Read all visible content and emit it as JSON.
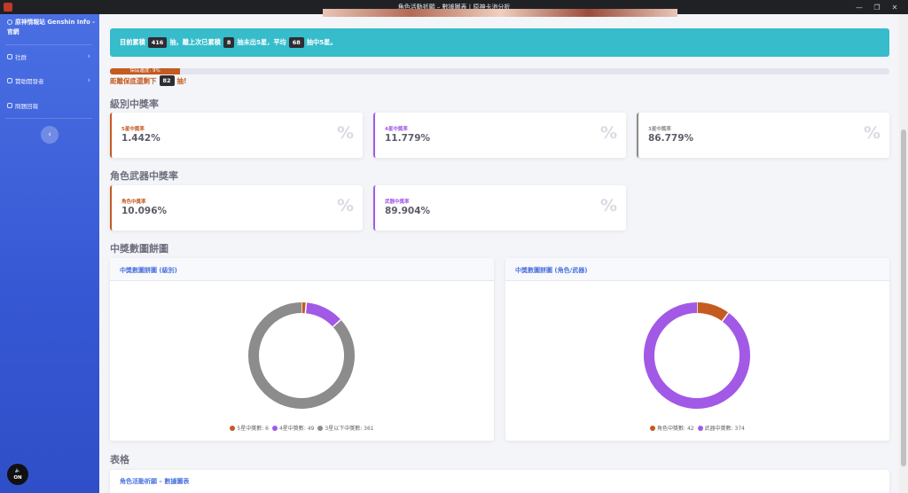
{
  "window": {
    "title": "角色活動祈願 – 數據圖表 | 原神卡池分析",
    "controls": {
      "minimize": "—",
      "maximize": "❐",
      "close": "✕"
    }
  },
  "sidebar": {
    "brand": "原神情報站 Genshin Info - 官網",
    "items": [
      {
        "label": "社群",
        "icon": "users-icon",
        "chevron": "›"
      },
      {
        "label": "贊助開發者",
        "icon": "heart-icon",
        "chevron": "›"
      },
      {
        "label": "問題回報",
        "icon": "feedback-icon"
      }
    ],
    "collapse_symbol": "‹",
    "audio_label": "ON"
  },
  "summary": {
    "prefix": "目前累積",
    "total_pulls": "416",
    "mid1": "抽，離上次已累積",
    "since_last": "8",
    "mid2": "抽未出5星，平均",
    "avg": "68",
    "suffix": "抽中5星。"
  },
  "pity": {
    "progress_label": "保底進度: 9%",
    "progress_value": 9,
    "remaining_prefix": "距離保底還剩下",
    "remaining": "82",
    "remaining_suffix": "抽!"
  },
  "sections": {
    "rarity_rate": "級別中獎率",
    "type_rate": "角色武器中獎率",
    "pie": "中獎數圖餅圖",
    "table": "表格"
  },
  "rarity_cards": [
    {
      "label": "5星中獎率",
      "value": "1.442%",
      "color": "#c45b20"
    },
    {
      "label": "4星中獎率",
      "value": "11.779%",
      "color": "#a259e6"
    },
    {
      "label": "3星中獎率",
      "value": "86.779%",
      "color": "#8c8c8c"
    }
  ],
  "type_cards": [
    {
      "label": "角色中獎率",
      "value": "10.096%",
      "color": "#c45b20"
    },
    {
      "label": "武器中獎率",
      "value": "89.904%",
      "color": "#a259e6"
    }
  ],
  "percent_symbol": "%",
  "charts": [
    {
      "title": "中獎數圖餅圖 (級別)",
      "legend": [
        "5星中獎數: 6",
        "4星中獎數: 49",
        "3星以下中獎數: 361"
      ]
    },
    {
      "title": "中獎數圖餅圖 (角色/武器)",
      "legend": [
        "角色中獎數: 42",
        "武器中獎數: 374"
      ]
    }
  ],
  "chart_data": [
    {
      "type": "pie",
      "donut": true,
      "title": "中獎數圖餅圖 (級別)",
      "categories": [
        "5星中獎數",
        "4星中獎數",
        "3星以下中獎數"
      ],
      "values": [
        6,
        49,
        361
      ],
      "colors": [
        "#c45b20",
        "#a259e6",
        "#8c8c8c"
      ],
      "legend_position": "bottom"
    },
    {
      "type": "pie",
      "donut": true,
      "title": "中獎數圖餅圖 (角色/武器)",
      "categories": [
        "角色中獎數",
        "武器中獎數"
      ],
      "values": [
        42,
        374
      ],
      "colors": [
        "#c45b20",
        "#a259e6"
      ],
      "legend_position": "bottom"
    }
  ],
  "table": {
    "title": "角色活動祈願 – 數據圖表"
  }
}
